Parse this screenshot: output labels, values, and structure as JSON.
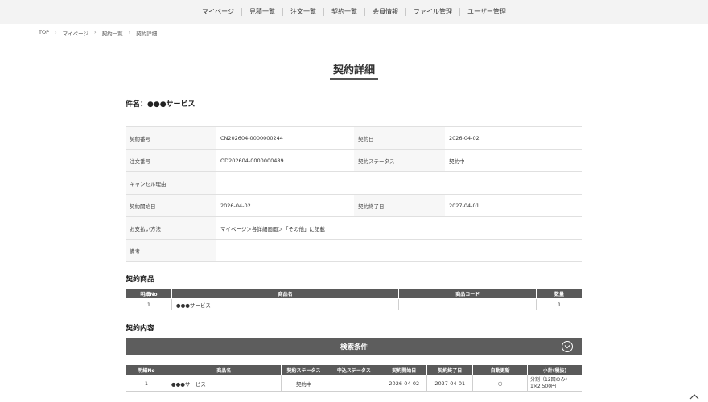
{
  "nav": [
    "マイページ",
    "見積一覧",
    "注文一覧",
    "契約一覧",
    "会員情報",
    "ファイル管理",
    "ユーザー管理"
  ],
  "breadcrumb": [
    "TOP",
    "マイページ",
    "契約一覧",
    "契約詳細"
  ],
  "page_title": "契約詳細",
  "subject": "件名：●●●サービス",
  "detail": {
    "contract_no_label": "契約番号",
    "contract_no": "CN202604-0000000244",
    "contract_date_label": "契約日",
    "contract_date": "2026-04-02",
    "order_no_label": "注文番号",
    "order_no": "OD202604-0000000489",
    "status_label": "契約ステータス",
    "status": "契約中",
    "cancel_label": "キャンセル理由",
    "cancel": "",
    "start_label": "契約開始日",
    "start": "2026-04-02",
    "end_label": "契約終了日",
    "end": "2027-04-01",
    "payment_label": "お支払い方法",
    "payment": "マイページ＞各詳細画面＞「その他」に記載",
    "note_label": "備考",
    "note": ""
  },
  "products": {
    "title": "契約商品",
    "headers": [
      "明細No",
      "商品名",
      "商品コード",
      "数量"
    ],
    "rows": [
      [
        "1",
        "●●●サービス",
        "",
        "1"
      ]
    ]
  },
  "contents": {
    "title": "契約内容",
    "search_label": "検索条件",
    "headers": [
      "明細No",
      "商品名",
      "契約ステータス",
      "申込ステータス",
      "契約開始日",
      "契約終了日",
      "自動更新",
      "小計(税抜)"
    ],
    "rows": [
      [
        "1",
        "●●●サービス",
        "契約中",
        "-",
        "2026-04-02",
        "2027-04-01",
        "○",
        "分割（12回のみ） 1×2,500円"
      ]
    ]
  },
  "icons": {
    "toggle": "chevron-down-circle-icon",
    "to_top": "chevron-up-icon"
  }
}
